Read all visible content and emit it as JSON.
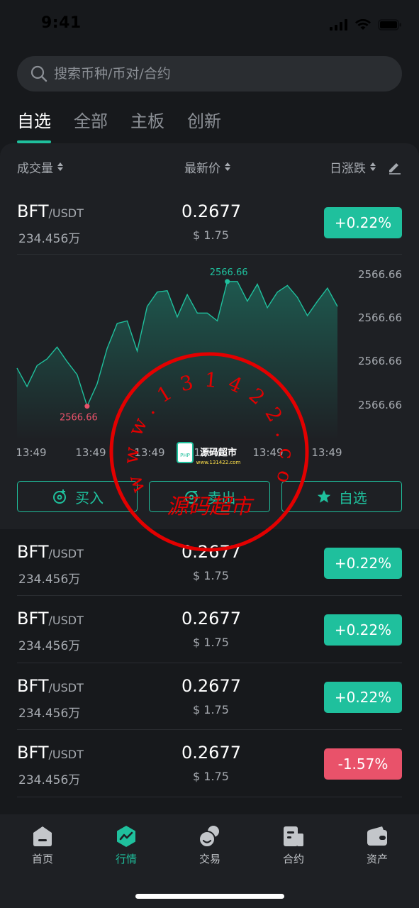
{
  "status_bar": {
    "time": "9:41"
  },
  "search": {
    "placeholder": "搜索币种/币对/合约"
  },
  "tabs": [
    {
      "label": "自选",
      "active": true
    },
    {
      "label": "全部",
      "active": false
    },
    {
      "label": "主板",
      "active": false
    },
    {
      "label": "创新",
      "active": false
    }
  ],
  "columns": {
    "volume": "成交量",
    "price": "最新价",
    "change": "日涨跌"
  },
  "rows": [
    {
      "base": "BFT",
      "quote": "/USDT",
      "volume": "234.456万",
      "price": "0.2677",
      "fiat": "$ 1.75",
      "change": "+0.22%",
      "direction": "up"
    },
    {
      "base": "BFT",
      "quote": "/USDT",
      "volume": "234.456万",
      "price": "0.2677",
      "fiat": "$ 1.75",
      "change": "+0.22%",
      "direction": "up"
    },
    {
      "base": "BFT",
      "quote": "/USDT",
      "volume": "234.456万",
      "price": "0.2677",
      "fiat": "$ 1.75",
      "change": "+0.22%",
      "direction": "up"
    },
    {
      "base": "BFT",
      "quote": "/USDT",
      "volume": "234.456万",
      "price": "0.2677",
      "fiat": "$ 1.75",
      "change": "+0.22%",
      "direction": "up"
    },
    {
      "base": "BFT",
      "quote": "/USDT",
      "volume": "234.456万",
      "price": "0.2677",
      "fiat": "$ 1.75",
      "change": "-1.57%",
      "direction": "down"
    }
  ],
  "chart_data": {
    "type": "area",
    "x_ticks": [
      "13:49",
      "13:49",
      "13:49",
      "13:49",
      "13:49",
      "13:49"
    ],
    "y_ticks": [
      "2566.66",
      "2566.66",
      "2566.66",
      "2566.66"
    ],
    "max_label": "2566.66",
    "min_label": "2566.66",
    "ylim": [
      0,
      100
    ],
    "values": [
      33,
      19,
      35,
      40,
      49,
      38,
      28,
      4,
      21,
      48,
      67,
      69,
      46,
      80,
      91,
      92,
      72,
      89,
      75,
      75,
      69,
      99,
      99,
      84,
      97,
      79,
      91,
      96,
      87,
      73,
      84,
      94,
      80
    ],
    "max_index": 21,
    "min_index": 7,
    "line_color": "#1fc09d"
  },
  "actions": [
    {
      "label": "买入",
      "icon": "coin-plus-icon"
    },
    {
      "label": "卖出",
      "icon": "coin-minus-icon"
    },
    {
      "label": "自选",
      "icon": "star-icon"
    }
  ],
  "tabbar": [
    {
      "label": "首页",
      "icon": "home-icon",
      "active": false
    },
    {
      "label": "行情",
      "icon": "market-icon",
      "active": true
    },
    {
      "label": "交易",
      "icon": "trade-icon",
      "active": false
    },
    {
      "label": "合约",
      "icon": "contract-icon",
      "active": false
    },
    {
      "label": "资产",
      "icon": "wallet-icon",
      "active": false
    }
  ],
  "watermark": {
    "ring_text": "www.131422.com",
    "bottom_text": "源码超市",
    "logo_text": "源码超市",
    "logo_url": "www.131422.com",
    "logo_badge": "PHP"
  }
}
